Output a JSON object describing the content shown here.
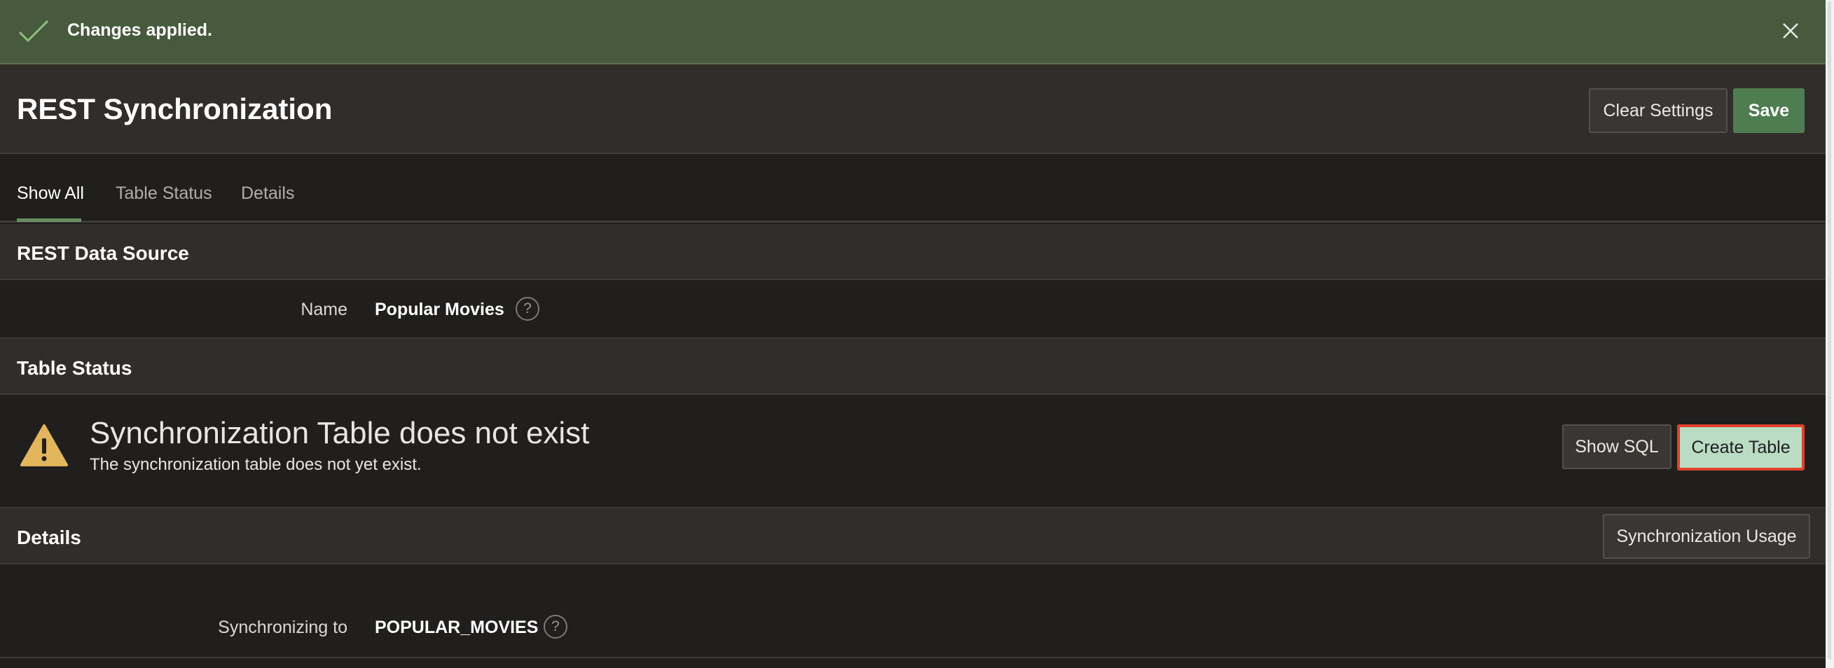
{
  "banner": {
    "message": "Changes applied.",
    "check_icon": "check-icon",
    "close_icon": "close-icon",
    "background": "#475a3e"
  },
  "header": {
    "title": "REST Synchronization",
    "clear_label": "Clear Settings",
    "save_label": "Save"
  },
  "tabs": [
    {
      "label": "Show All",
      "active": true
    },
    {
      "label": "Table Status",
      "active": false
    },
    {
      "label": "Details",
      "active": false
    }
  ],
  "rest_data_source": {
    "title": "REST Data Source",
    "name_label": "Name",
    "name_value": "Popular Movies",
    "help_glyph": "?"
  },
  "table_status": {
    "title": "Table Status",
    "alert_title": "Synchronization Table does not exist",
    "alert_text": "The synchronization table does not yet exist.",
    "alert_icon": "warning-icon",
    "alert_color": "#e3b55d",
    "show_sql_label": "Show SQL",
    "create_table_label": "Create Table"
  },
  "details": {
    "title": "Details",
    "usage_label": "Synchronization Usage",
    "sync_to_label": "Synchronizing to",
    "sync_to_value": "POPULAR_MOVIES",
    "help_glyph": "?"
  },
  "colors": {
    "accent_green": "#4f7d52",
    "highlight_border": "#e0412c",
    "create_button_fill": "#b9dcc2"
  }
}
